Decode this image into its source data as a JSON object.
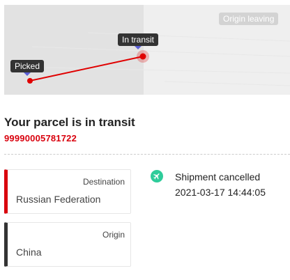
{
  "map": {
    "markers": {
      "picked": "Picked",
      "in_transit": "In transit",
      "origin_leaving": "Origin leaving"
    },
    "route_color": "#e00000"
  },
  "parcel": {
    "status_title": "Your parcel is in transit",
    "tracking_number": "99990005781722"
  },
  "destination": {
    "label": "Destination",
    "value": "Russian Federation",
    "accent": "#d9000d"
  },
  "origin": {
    "label": "Origin",
    "value": "China",
    "accent": "#333333"
  },
  "latest_event": {
    "icon": "airplane-icon",
    "icon_color": "#2ecc9a",
    "status": "Shipment cancelled",
    "datetime": "2021-03-17 14:44:05"
  }
}
